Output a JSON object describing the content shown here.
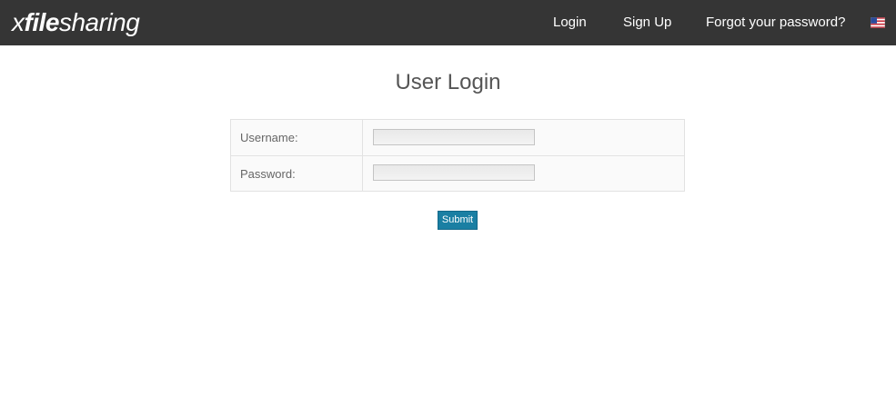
{
  "header": {
    "logo": {
      "thin_prefix": "x",
      "bold": "file",
      "thin_suffix": "sharing"
    },
    "nav": {
      "login": "Login",
      "signup": "Sign Up",
      "forgot": "Forgot your password?"
    },
    "language_icon": "us-flag-icon"
  },
  "main": {
    "title": "User Login",
    "form": {
      "username_label": "Username:",
      "username_value": "",
      "password_label": "Password:",
      "password_value": "",
      "submit_label": "Submit"
    }
  },
  "colors": {
    "header_bg": "#353535",
    "button_bg": "#1a7fa3",
    "title_text": "#555555"
  }
}
